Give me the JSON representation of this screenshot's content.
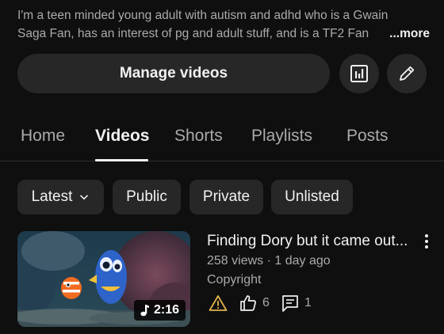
{
  "description": {
    "line1": "I'm a teen minded young adult with autism and adhd who is a Gwain",
    "line2": "Saga Fan, has an interest of pg and adult stuff, and is a TF2 Fan",
    "more_label": "...more"
  },
  "actions": {
    "manage_label": "Manage videos",
    "analytics_icon": "analytics-icon",
    "edit_icon": "pencil-icon"
  },
  "tabs": [
    {
      "label": "Home",
      "active": false
    },
    {
      "label": "Videos",
      "active": true
    },
    {
      "label": "Shorts",
      "active": false
    },
    {
      "label": "Playlists",
      "active": false
    },
    {
      "label": "Posts",
      "active": false
    }
  ],
  "filters": [
    {
      "label": "Latest",
      "has_dropdown": true
    },
    {
      "label": "Public"
    },
    {
      "label": "Private"
    },
    {
      "label": "Unlisted"
    }
  ],
  "video": {
    "title": "Finding Dory but it came out...",
    "views": "258 views",
    "separator": " · ",
    "age": "1 day ago",
    "status": "Copyright",
    "duration": "2:16",
    "likes": "6",
    "comments": "1"
  },
  "colors": {
    "background": "#0f0f0f",
    "surface": "#272727",
    "text_primary": "#f1f1f1",
    "text_secondary": "#aaaaaa",
    "warning": "#e0b44a"
  }
}
